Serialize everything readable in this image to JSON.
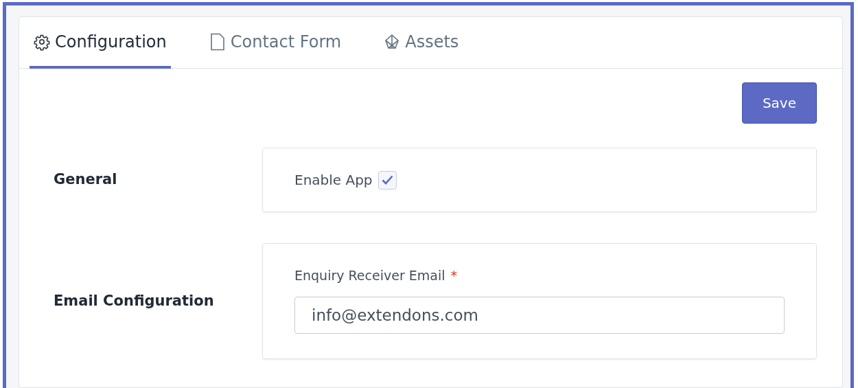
{
  "tabs": [
    {
      "label": "Configuration",
      "selected": true
    },
    {
      "label": "Contact Form",
      "selected": false
    },
    {
      "label": "Assets",
      "selected": false
    }
  ],
  "save_button": "Save",
  "sections": [
    {
      "title": "General",
      "kind": "checkbox",
      "label": "Enable App",
      "checked": true
    },
    {
      "title": "Email Configuration",
      "kind": "field",
      "label": "Enquiry Receiver Email",
      "required_mark": "*",
      "value": "info@extendons.com"
    }
  ]
}
